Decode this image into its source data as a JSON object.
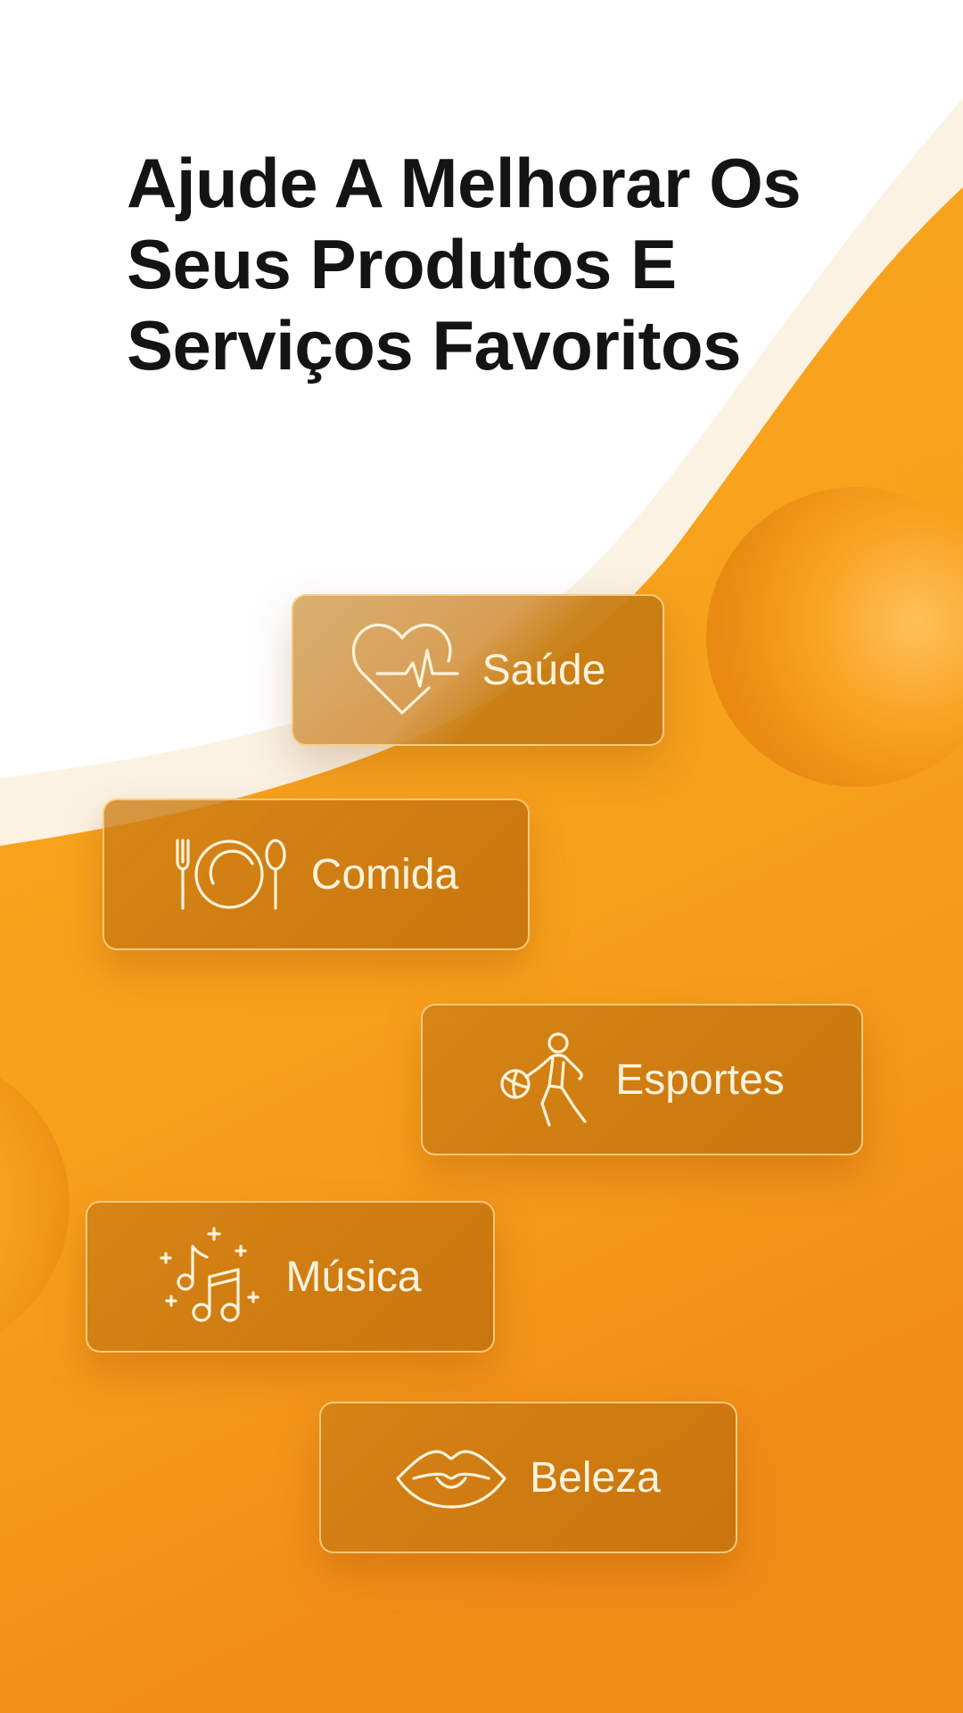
{
  "headline": {
    "line1": "Ajude A Melhorar Os",
    "line2": "Seus Produtos E",
    "line3": "Serviços Favoritos"
  },
  "categories": [
    {
      "label": "Saúde",
      "icon": "heart-pulse-icon"
    },
    {
      "label": "Comida",
      "icon": "plate-cutlery-icon"
    },
    {
      "label": "Esportes",
      "icon": "basketball-player-icon"
    },
    {
      "label": "Música",
      "icon": "music-notes-icon"
    },
    {
      "label": "Beleza",
      "icon": "lips-icon"
    }
  ],
  "colors": {
    "background_top": "#ffffff",
    "wave_cream": "#fbf2e3",
    "orange_light": "#f8a11c",
    "orange_dark": "#f08b16",
    "chip_fill": "#c67a12",
    "chip_border": "#ffd88c",
    "chip_text": "#fff3dc",
    "headline_text": "#141414"
  }
}
